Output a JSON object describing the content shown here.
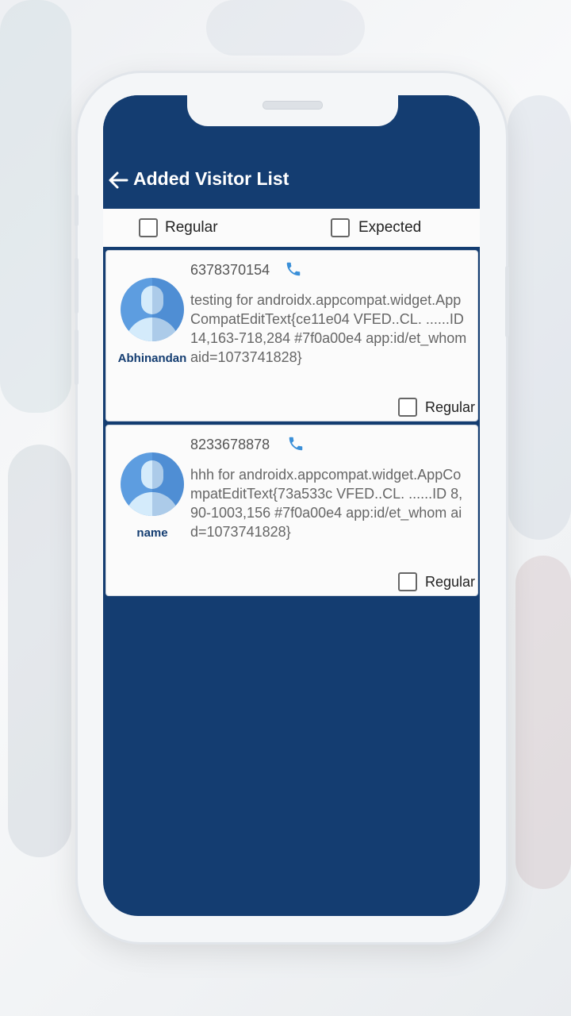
{
  "appbar": {
    "title": "Added Visitor List"
  },
  "filters": {
    "regular_label": "Regular",
    "expected_label": "Expected"
  },
  "visitors": [
    {
      "name": "Abhinandan",
      "phone": "6378370154",
      "description": "testing for androidx.appcompat.widget.AppCompatEditText{ce11e04 VFED..CL. ......ID 14,163-718,284 #7f0a00e4 app:id/et_whom aid=1073741828}",
      "checkbox_label": "Regular"
    },
    {
      "name": "name",
      "phone": "8233678878",
      "description": "hhh for androidx.appcompat.widget.AppCompatEditText{73a533c VFED..CL. ......ID 8,90-1003,156 #7f0a00e4 app:id/et_whom aid=1073741828}",
      "checkbox_label": "Regular"
    }
  ],
  "colors": {
    "primary": "#143d71",
    "avatar": "#5d9de0",
    "call_icon": "#3a8fd8"
  }
}
